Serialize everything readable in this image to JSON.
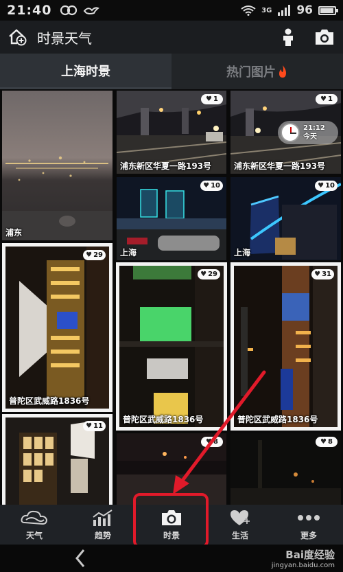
{
  "status_bar": {
    "time": "21:40",
    "network": "3G",
    "battery": "96",
    "battery_level": 0.96
  },
  "title_bar": {
    "title": "时景天气",
    "left_icon": "home-add-icon",
    "right_icons": [
      "person-icon",
      "camera-icon"
    ]
  },
  "tabs": [
    {
      "label": "上海时景",
      "active": true
    },
    {
      "label": "热门图片",
      "active": false,
      "icon": "flame-icon"
    }
  ],
  "photos": [
    {
      "label": "浦东",
      "likes": ""
    },
    {
      "label": "浦东新区华夏一路193号",
      "likes": "1"
    },
    {
      "label": "浦东新区华夏一路193号",
      "likes": "1",
      "clock_time": "21:12",
      "clock_day": "今天"
    },
    {
      "label": "上海",
      "likes": "10"
    },
    {
      "label": "上海",
      "likes": "10"
    },
    {
      "label": "普陀区武威路1836号",
      "likes": "29"
    },
    {
      "label": "普陀区武威路1836号",
      "likes": "29"
    },
    {
      "label": "普陀区武威路1836号",
      "likes": "31"
    },
    {
      "label": "",
      "likes": "11"
    },
    {
      "label": "",
      "likes": "8"
    },
    {
      "label": "",
      "likes": "8"
    }
  ],
  "bottom_nav": [
    {
      "label": "天气",
      "icon": "weather-cloud-icon"
    },
    {
      "label": "趋势",
      "icon": "trend-chart-icon"
    },
    {
      "label": "时景",
      "icon": "camera-icon"
    },
    {
      "label": "生活",
      "icon": "heart-plus-icon"
    },
    {
      "label": "更多",
      "icon": "more-dots-icon"
    }
  ],
  "watermark": {
    "brand": "Bai度经验",
    "url": "jingyan.baidu.com"
  },
  "colors": {
    "highlight": "#e11a2a",
    "flame": "#ff4a1c",
    "bar_bg": "#1f2226"
  }
}
